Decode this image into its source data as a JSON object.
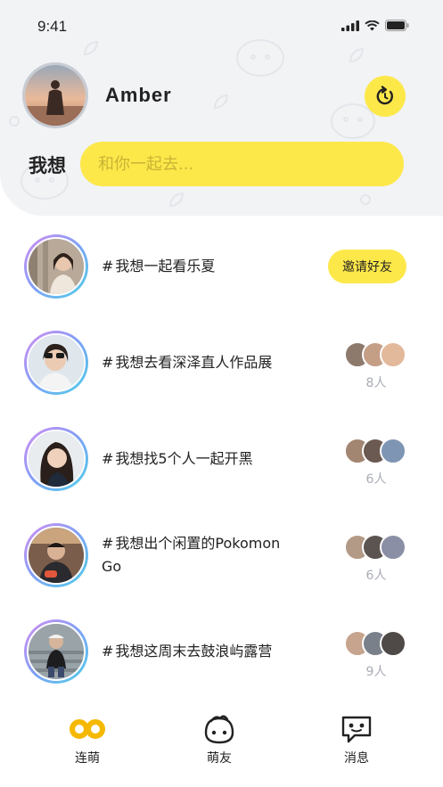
{
  "status": {
    "time": "9:41"
  },
  "profile": {
    "name": "Amber"
  },
  "want": {
    "label": "我想",
    "placeholder": "和你一起去..."
  },
  "items": [
    {
      "hash": "#",
      "text": "我想一起看乐夏",
      "invite_label": "邀请好友"
    },
    {
      "hash": "#",
      "text": "我想去看深泽直人作品展",
      "count": "8人"
    },
    {
      "hash": "#",
      "text": "我想找5个人一起开黑",
      "count": "6人"
    },
    {
      "hash": "#",
      "text": "我想出个闲置的Pokomon Go",
      "count": "6人"
    },
    {
      "hash": "#",
      "text": "我想这周末去鼓浪屿露营",
      "count": "9人"
    }
  ],
  "tabs": [
    {
      "label": "连萌",
      "icon": "infinity-icon"
    },
    {
      "label": "萌友",
      "icon": "friend-face-icon"
    },
    {
      "label": "消息",
      "icon": "message-icon"
    }
  ],
  "colors": {
    "accent": "#fde84a",
    "header_bg": "#f2f3f5",
    "muted": "#a9adb4"
  }
}
